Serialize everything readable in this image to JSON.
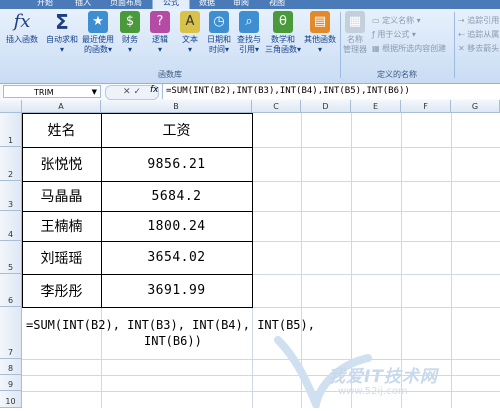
{
  "ribbon": {
    "tabs": [
      "开始",
      "插入",
      "页面布局",
      "公式",
      "数据",
      "审阅",
      "视图"
    ],
    "active_tab": "公式",
    "buttons": [
      {
        "label1": "插入函数",
        "label2": ""
      },
      {
        "label1": "自动求和",
        "label2": "▾"
      },
      {
        "label1": "最近使用",
        "label2": "的函数▾"
      },
      {
        "label1": "财务",
        "label2": "▾"
      },
      {
        "label1": "逻辑",
        "label2": "▾"
      },
      {
        "label1": "文本",
        "label2": "▾"
      },
      {
        "label1": "日期和",
        "label2": "时间▾"
      },
      {
        "label1": "查找与",
        "label2": "引用▾"
      },
      {
        "label1": "数学和",
        "label2": "三角函数▾"
      },
      {
        "label1": "其他函数",
        "label2": "▾"
      },
      {
        "label1": "名称",
        "label2": "管理器"
      }
    ],
    "group_library": "函数库",
    "group_names": "定义的名称",
    "names_items": [
      "定义名称 ▾",
      "用于公式 ▾",
      "根据所选内容创建"
    ],
    "audit_items": [
      "追踪引用",
      "追踪从属",
      "移去箭头"
    ]
  },
  "formula_bar": {
    "name_box": "TRIM",
    "fx": "fx",
    "formula": "=SUM(INT(B2),INT(B3),INT(B4),INT(B5),INT(B6))"
  },
  "columns": [
    "A",
    "B",
    "C",
    "D",
    "E",
    "F",
    "G"
  ],
  "rows": [
    "1",
    "2",
    "3",
    "4",
    "5",
    "6",
    "7",
    "8",
    "9",
    "10"
  ],
  "table": {
    "header_name": "姓名",
    "header_salary": "工资",
    "rows": [
      {
        "name": "张悦悦",
        "salary": "9856.21"
      },
      {
        "name": "马晶晶",
        "salary": "5684.2"
      },
      {
        "name": "王楠楠",
        "salary": "1800.24"
      },
      {
        "name": "刘瑶瑶",
        "salary": "3654.02"
      },
      {
        "name": "李彤彤",
        "salary": "3691.99"
      }
    ]
  },
  "a7": {
    "line1": "=SUM(INT(B2), INT(B3), INT(B4), INT(B5),",
    "line2": "INT(B6))"
  },
  "watermark": {
    "text": "我爱IT技术网",
    "url": "www.52ij.com"
  },
  "colors": {
    "accent": "#4a7ab8",
    "ribbon_text": "#15428b",
    "grid": "#d0d7e5"
  }
}
